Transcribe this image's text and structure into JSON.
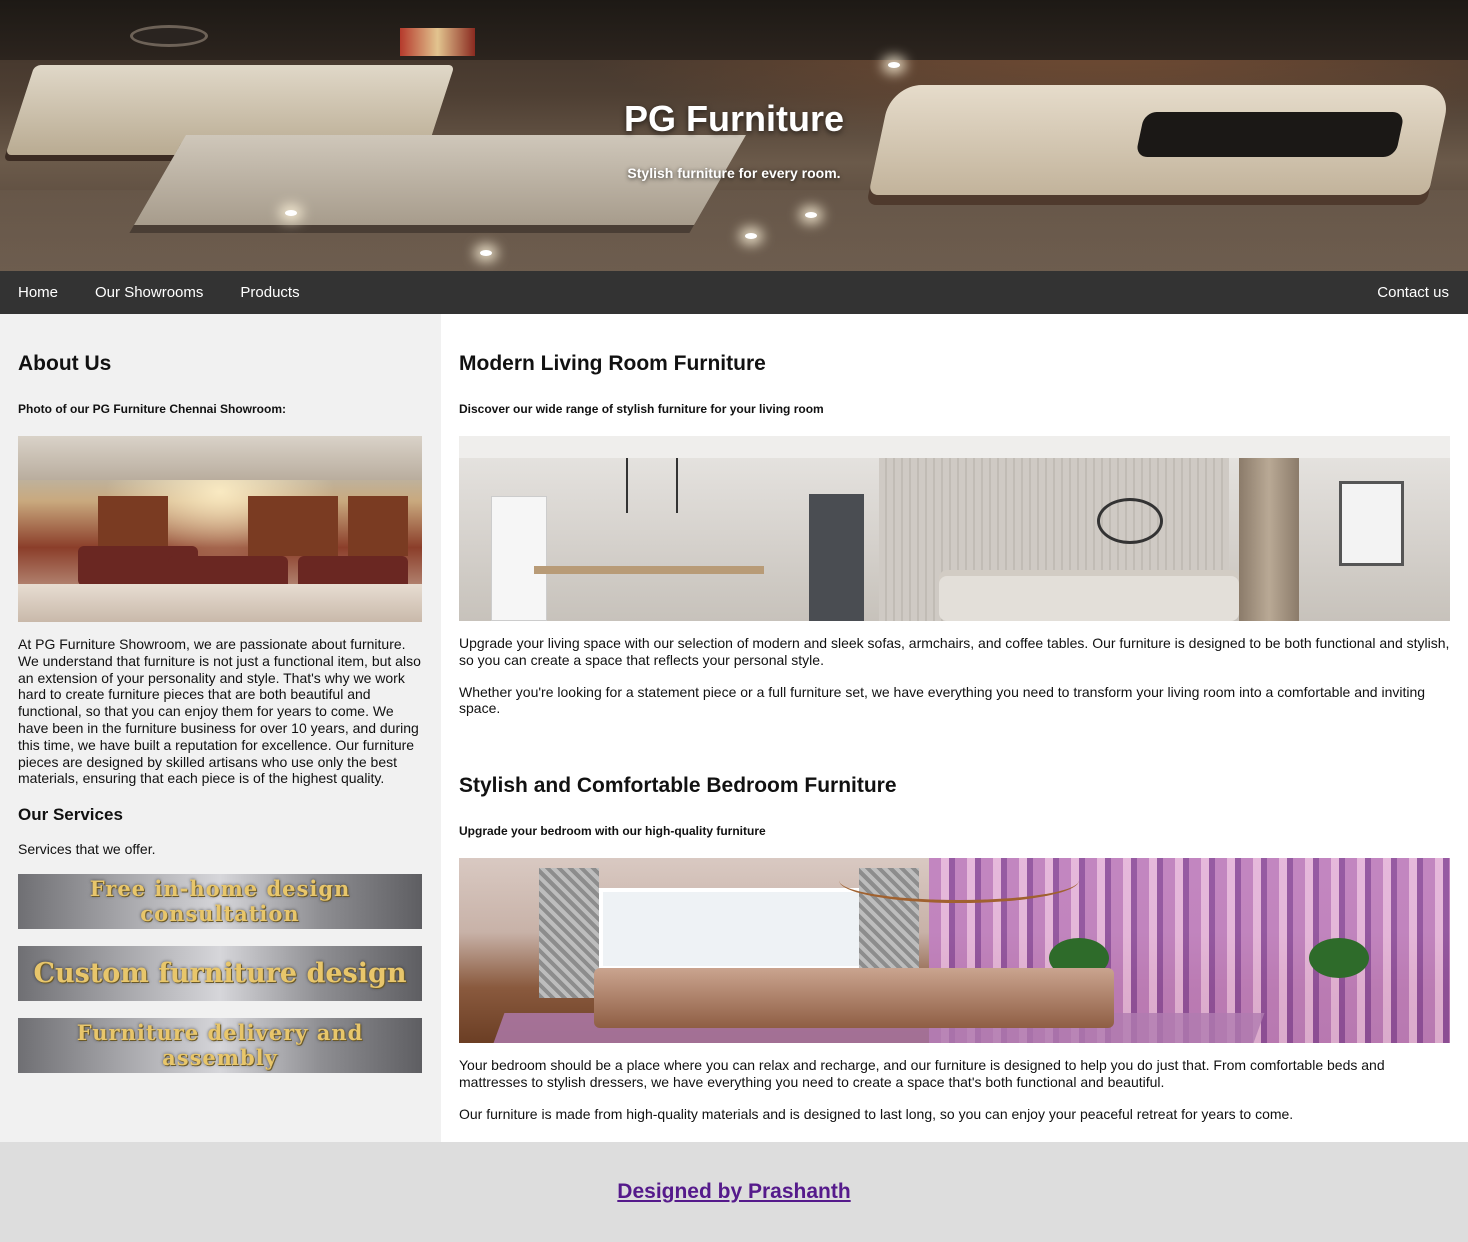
{
  "hero": {
    "title": "PG Furniture",
    "tagline": "Stylish furniture for every room."
  },
  "nav": {
    "items": [
      "Home",
      "Our Showrooms",
      "Products"
    ],
    "contact": "Contact us"
  },
  "sidebar": {
    "about_heading": "About Us",
    "photo_caption": "Photo of our PG Furniture Chennai Showroom:",
    "about_text": "At PG Furniture Showroom, we are passionate about furniture. We understand that furniture is not just a functional item, but also an extension of your personality and style. That's why we work hard to create furniture pieces that are both beautiful and functional, so that you can enjoy them for years to come. We have been in the furniture business for over 10 years, and during this time, we have built a reputation for excellence. Our furniture pieces are designed by skilled artisans who use only the best materials, ensuring that each piece is of the highest quality.",
    "services_heading": "Our Services",
    "services_intro": "Services that we offer.",
    "services": [
      "Free in-home design consultation",
      "Custom furniture design",
      "Furniture delivery and assembly"
    ]
  },
  "content": {
    "living": {
      "heading": "Modern Living Room Furniture",
      "subheading": "Discover our wide range of stylish furniture for your living room",
      "para1": "Upgrade your living space with our selection of modern and sleek sofas, armchairs, and coffee tables. Our furniture is designed to be both functional and stylish, so you can create a space that reflects your personal style.",
      "para2": "Whether you're looking for a statement piece or a full furniture set, we have everything you need to transform your living room into a comfortable and inviting space."
    },
    "bedroom": {
      "heading": "Stylish and Comfortable Bedroom Furniture",
      "subheading": "Upgrade your bedroom with our high-quality furniture",
      "para1": "Your bedroom should be a place where you can relax and recharge, and our furniture is designed to help you do just that. From comfortable beds and mattresses to stylish dressers, we have everything you need to create a space that's both functional and beautiful.",
      "para2": "Our furniture is made from high-quality materials and is designed to last long, so you can enjoy your peaceful retreat for years to come."
    }
  },
  "footer": {
    "credit": "Designed by Prashanth"
  }
}
